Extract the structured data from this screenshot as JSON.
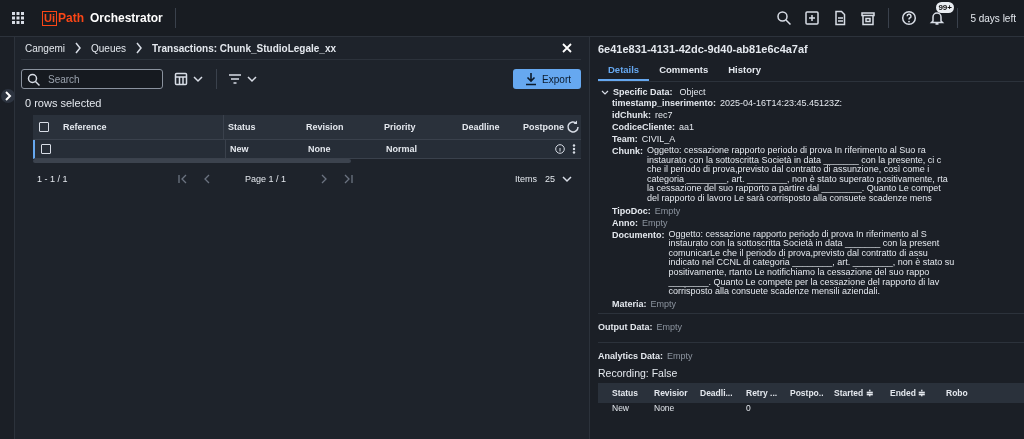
{
  "topbar": {
    "logo_mark": "Ui",
    "logo_text": "Path",
    "app_name": "Orchestrator",
    "notification_badge": "99+",
    "trial": "5 days left"
  },
  "breadcrumb": [
    "Cangemi",
    "Queues",
    "Transactions: Chunk_StudioLegale_xx"
  ],
  "search": {
    "placeholder": "Search"
  },
  "export_button": "Export",
  "selection_status": "0 rows selected",
  "table": {
    "select_all_checked": false,
    "columns": [
      "Reference",
      "Status",
      "Revision",
      "Priority",
      "Deadline",
      "Postpone"
    ],
    "rows": [
      {
        "selected": true,
        "checked": false,
        "status": "New",
        "revision": "None",
        "priority": "Normal"
      }
    ]
  },
  "pagination": {
    "range": "1 - 1 / 1",
    "page": "Page 1 / 1",
    "items_label": "Items",
    "items_per_page": "25"
  },
  "details": {
    "id": "6e41e831-4131-42dc-9d40-ab81e6c4a7af",
    "tabs": [
      {
        "label": "Details",
        "selected": true
      },
      {
        "label": "Comments",
        "selected": false
      },
      {
        "label": "History",
        "selected": false
      }
    ],
    "specific_data": {
      "label": "Specific Data:",
      "value": "Object",
      "expanded": true,
      "fields": [
        {
          "kind": "text",
          "key": "timestamp_inserimento:",
          "value": "2025-04-16T14:23:45.45123Z:"
        },
        {
          "kind": "text",
          "key": "idChunk:",
          "value": "rec7"
        },
        {
          "kind": "text",
          "key": "CodiceCliente:",
          "value": "aa1"
        },
        {
          "kind": "text",
          "key": "Team:",
          "value": "CIVIL_A"
        },
        {
          "kind": "lines",
          "key": "Chunk:",
          "lines": [
            "Oggetto: cessazione rapporto periodo di prova In riferimento al Suo ra",
            "instaurato con la sottoscritta Società in data _______ con la presente, ci c",
            "che il periodo di prova,previsto dal contratto di assunzione, così come i",
            "categoria ________, art. ________, non è stato superato positivamente,  rta",
            "la cessazione del suo rapporto a partire dal ________.  Quanto Le compet",
            "del rapporto di lavoro Le sarà corrisposto alla consuete scadenze mens"
          ]
        },
        {
          "kind": "empty",
          "key": "TipoDoc:",
          "value": "Empty"
        },
        {
          "kind": "empty",
          "key": "Anno:",
          "value": "Empty"
        },
        {
          "kind": "lines",
          "key": "Documento:",
          "lines": [
            "Oggetto: cessazione rapporto periodo di prova In riferimento al S",
            "instaurato con la sottoscritta Società in data _______ con la present",
            "comunicarLe che il periodo di prova,previsto dal contratto di assu",
            "indicato nel CCNL di categoria ________, art. ________, non è stato su",
            "positivamente,  rtanto Le notifichiamo la cessazione del suo rappo",
            "________.  Quanto Le compete per la cessazione del rapporto di lav",
            "corrisposto alla consuete scadenze mensili aziendali."
          ]
        },
        {
          "kind": "empty",
          "key": "Materia:",
          "value": "Empty"
        }
      ]
    },
    "output_data": {
      "key": "Output Data:",
      "value": "Empty"
    },
    "analytics_data": {
      "key": "Analytics Data:",
      "value": "Empty"
    },
    "recording": "Recording: False",
    "history_table": {
      "columns": [
        "Status",
        "Revisior",
        "Deadli...",
        "Retry ...",
        "Postpo..",
        "Started ≑",
        "Ended ≑",
        "Robo"
      ],
      "rows": [
        {
          "status": "New",
          "revision": "None",
          "retry": "0"
        }
      ]
    }
  }
}
